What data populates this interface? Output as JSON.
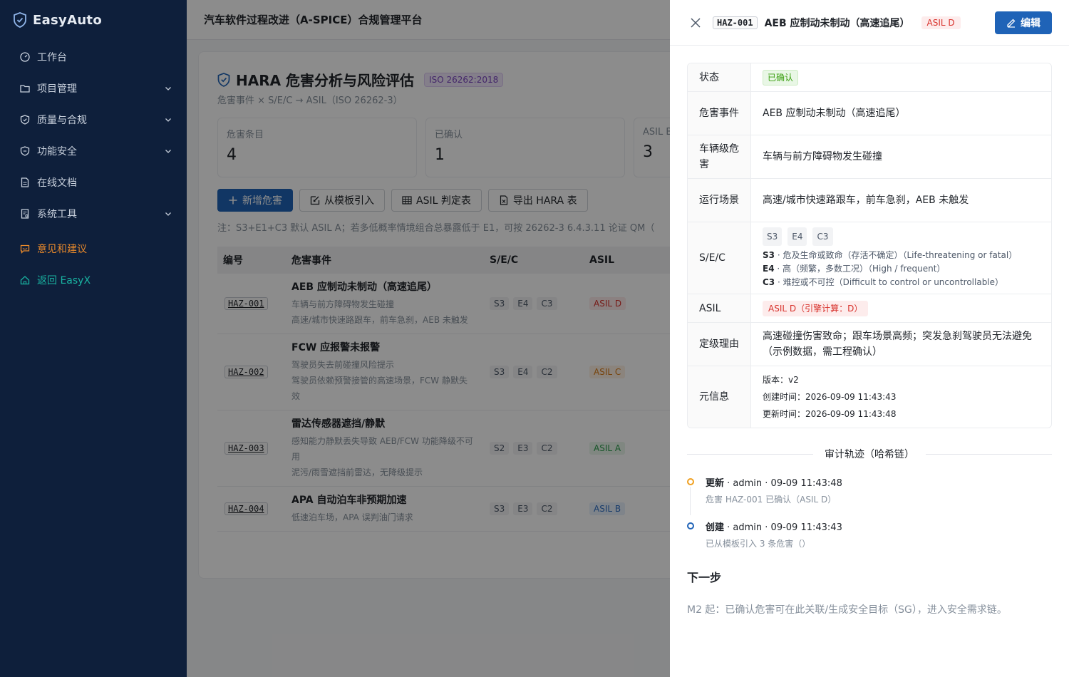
{
  "brand": {
    "name": "EasyAuto"
  },
  "sidebar": {
    "items": [
      {
        "label": "工作台",
        "icon": "dashboard-icon",
        "has_children": false
      },
      {
        "label": "项目管理",
        "icon": "folder-icon",
        "has_children": true
      },
      {
        "label": "质量与合规",
        "icon": "shield-icon",
        "has_children": true
      },
      {
        "label": "功能安全",
        "icon": "shield-check-icon",
        "has_children": true
      },
      {
        "label": "在线文档",
        "icon": "document-icon",
        "has_children": false
      },
      {
        "label": "系统工具",
        "icon": "tool-icon",
        "has_children": true
      }
    ],
    "feedback": "意见和建议",
    "back": "返回 EasyX"
  },
  "topbar": {
    "title": "汽车软件过程改进（A-SPICE）合规管理平台"
  },
  "page": {
    "title": "HARA 危害分析与风险评估",
    "standard_tag": "ISO 26262:2018",
    "subtitle": "危害事件 × S/E/C → ASIL（ISO 26262-3）",
    "stats": [
      {
        "label": "危害条目",
        "value": "4"
      },
      {
        "label": "已确认",
        "value": "1"
      },
      {
        "label": "ASIL B",
        "value": "3"
      }
    ],
    "buttons": {
      "add": "新增危害",
      "import": "从模板引入",
      "asil_table": "ASIL 判定表",
      "export": "导出 HARA 表"
    },
    "note": "注：S3+E1+C3 默认 ASIL A；若多低概率情境组合总暴露低于 E1，可按 26262-3 6.4.3.11 论证 QM（",
    "table": {
      "headers": [
        "编号",
        "危害事件",
        "S/E/C",
        "ASIL"
      ],
      "rows": [
        {
          "code": "HAZ-001",
          "title": "AEB 应制动未制动（高速追尾）",
          "lines": [
            "车辆与前方障碍物发生碰撞",
            "高速/城市快速路跟车，前车急刹，AEB 未触发"
          ],
          "s": "S3",
          "e": "E4",
          "c": "C3",
          "asil": "ASIL D",
          "asil_class": "d"
        },
        {
          "code": "HAZ-002",
          "title": "FCW 应报警未报警",
          "lines": [
            "驾驶员失去前碰撞风险提示",
            "驾驶员依赖预警接管的高速场景，FCW 静默失",
            "效"
          ],
          "s": "S3",
          "e": "E4",
          "c": "C2",
          "asil": "ASIL C",
          "asil_class": "c"
        },
        {
          "code": "HAZ-003",
          "title": "雷达传感器遮挡/静默",
          "lines": [
            "感知能力静默丢失导致 AEB/FCW 功能降级不可",
            "用",
            "泥污/雨雪遮挡前雷达，无降级提示"
          ],
          "s": "S2",
          "e": "E3",
          "c": "C2",
          "asil": "ASIL A",
          "asil_class": "a"
        },
        {
          "code": "HAZ-004",
          "title": "APA 自动泊车非预期加速",
          "lines": [
            "低速泊车场，APA 误判油门请求"
          ],
          "s": "S3",
          "e": "E3",
          "c": "C2",
          "asil": "ASIL B",
          "asil_class": "b"
        }
      ]
    }
  },
  "drawer": {
    "code": "HAZ-001",
    "title": "AEB 应制动未制动（高速追尾）",
    "asil": "ASIL D",
    "edit_label": "编辑",
    "fields": {
      "status_label": "状态",
      "status_value": "已确认",
      "event_label": "危害事件",
      "event_value": "AEB 应制动未制动（高速追尾）",
      "hazard_label": "车辆级危害",
      "hazard_value": "车辆与前方障碍物发生碰撞",
      "scenario_label": "运行场景",
      "scenario_value": "高速/城市快速路跟车，前车急刹，AEB 未触发",
      "sec_label": "S/E/C",
      "sec_chips": [
        "S3",
        "E4",
        "C3"
      ],
      "sec_lines": [
        {
          "code": "S3",
          "text": " · 危及生命或致命（存活不确定）（Life-threatening or fatal）"
        },
        {
          "code": "E4",
          "text": " · 高（频繁，多数工况）（High / frequent）"
        },
        {
          "code": "C3",
          "text": " · 难控或不可控（Difficult to control or uncontrollable）"
        }
      ],
      "asil_label": "ASIL",
      "asil_value": "ASIL D（引擎计算：D）",
      "reason_label": "定级理由",
      "reason_value": "高速碰撞伤害致命；跟车场景高频；突发急刹驾驶员无法避免（示例数据，需工程确认）",
      "meta_label": "元信息",
      "meta_version": "版本：v2",
      "meta_created": "创建时间：2026-09-09 11:43:43",
      "meta_updated": "更新时间：2026-09-09 11:43:48"
    },
    "audit_title": "审计轨迹（哈希链）",
    "audit": [
      {
        "action": "更新",
        "meta": " · admin · 09-09 11:43:48",
        "desc": "危害 HAZ-001 已确认（ASIL D）",
        "color": "#f0a020"
      },
      {
        "action": "创建",
        "meta": " · admin · 09-09 11:43:43",
        "desc": "已从模板引入 3 条危害（）",
        "color": "#1f63b7"
      }
    ],
    "next_title": "下一步",
    "next_text": "M2 起：已确认危害可在此关联/生成安全目标（SG），进入安全需求链。"
  }
}
